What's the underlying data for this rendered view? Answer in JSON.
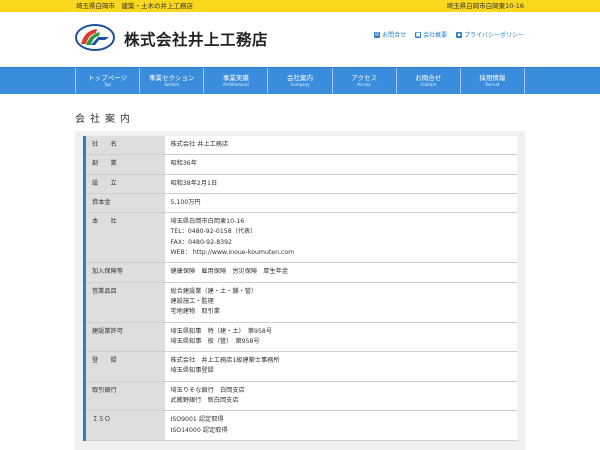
{
  "topbar": {
    "left": "埼玉県白岡市　建築・土木の井上工務店",
    "right": "埼玉県白岡市白岡東10-16"
  },
  "header": {
    "company_name": "株式会社井上工務店",
    "links": [
      {
        "icon": "mail-icon",
        "icon_glyph": "✉",
        "label": "お問合せ"
      },
      {
        "icon": "building-icon",
        "icon_glyph": "■",
        "label": "会社概要"
      },
      {
        "icon": "lock-icon",
        "icon_glyph": "▪",
        "label": "プライバシーポリシー"
      }
    ]
  },
  "nav": [
    {
      "jp": "トップページ",
      "en": "Top"
    },
    {
      "jp": "事業セクション",
      "en": "Section"
    },
    {
      "jp": "事業実績",
      "en": "Architectural"
    },
    {
      "jp": "会社案内",
      "en": "Company"
    },
    {
      "jp": "アクセス",
      "en": "Access"
    },
    {
      "jp": "お問合せ",
      "en": "Contact"
    },
    {
      "jp": "採用情報",
      "en": "Recruit"
    }
  ],
  "page_title": "会社案内",
  "table": [
    {
      "label": "社　　名",
      "lines": [
        "株式会社 井上工務店"
      ]
    },
    {
      "label": "創　　業",
      "lines": [
        "昭和36年"
      ]
    },
    {
      "label": "設　　立",
      "lines": [
        "昭和38年2月1日"
      ]
    },
    {
      "label": "資本金",
      "lines": [
        "5,100万円"
      ]
    },
    {
      "label": "本　　社",
      "lines": [
        "埼玉県白岡市白岡東10-16",
        "TEL：0480-92-0158（代表）",
        "FAX：0480-92-8392",
        "WEB： http://www.inoue-koumuten.com"
      ]
    },
    {
      "label": "加入保険等",
      "lines": [
        "健康保険　雇用保険　労災保険　厚生年金"
      ]
    },
    {
      "label": "営業品目",
      "lines": [
        "総合建設業（建・土・舗・管）",
        "建設施工・監理",
        "宅地建物　取引業"
      ]
    },
    {
      "label": "建設業許可",
      "lines": [
        "埼玉県知事　特（建・土）　第958号",
        "埼玉県知事　般（管）　第958号"
      ]
    },
    {
      "label": "登　　録",
      "lines": [
        "株式会社　井上工務店1級建築士事務所",
        "埼玉県知事登録"
      ]
    },
    {
      "label": "取引銀行",
      "lines": [
        "埼玉りそな銀行　白岡支店",
        "武蔵野銀行　新白岡支店"
      ]
    },
    {
      "label": "ＩＳＯ",
      "lines": [
        "ISO9001 認定取得",
        "ISO14000 認定取得"
      ]
    }
  ],
  "colors": {
    "topbar": "#f8d71c",
    "nav": "#3a8ddc",
    "accent": "#2b7fc8",
    "label_bg": "#dedede",
    "content_bg": "#f0f0f0"
  }
}
